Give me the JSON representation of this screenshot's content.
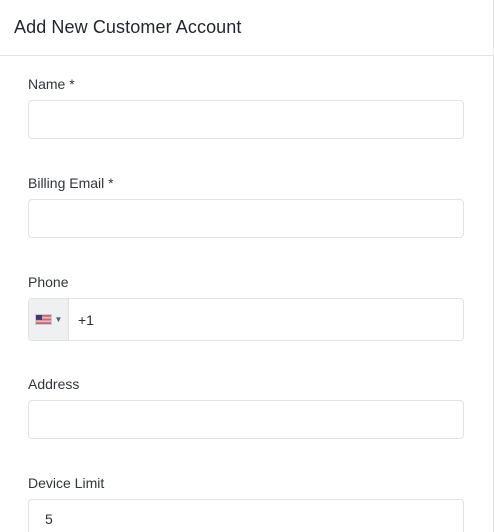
{
  "dialog": {
    "title": "Add New Customer Account"
  },
  "form": {
    "name": {
      "label": "Name *",
      "value": "",
      "placeholder": ""
    },
    "billing_email": {
      "label": "Billing Email *",
      "value": "",
      "placeholder": ""
    },
    "phone": {
      "label": "Phone",
      "value": "+1",
      "country_flag": "us-flag-icon",
      "dropdown_icon": "caret-down-icon"
    },
    "address": {
      "label": "Address",
      "value": "",
      "placeholder": ""
    },
    "device_limit": {
      "label": "Device Limit",
      "value": "5"
    }
  },
  "colors": {
    "border": "#dfe2e6",
    "text": "#2b2f38",
    "flag_bg": "#eef0f2"
  }
}
